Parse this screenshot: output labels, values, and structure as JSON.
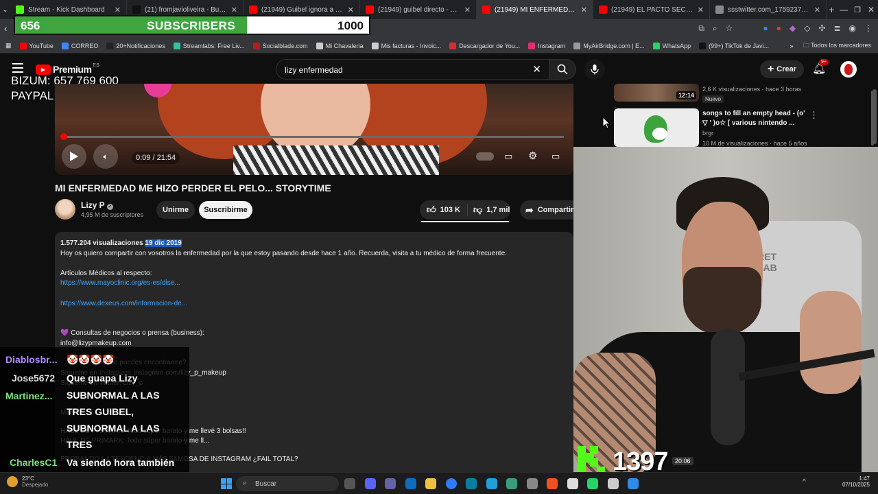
{
  "tabs": [
    {
      "title": "Stream - Kick Dashboard",
      "color": "#53fc18"
    },
    {
      "title": "(21) fromjavioliveira - Buscar /",
      "color": "#111111"
    },
    {
      "title": "(21949) Guibel ignora a JaviOli",
      "color": "#ff0000"
    },
    {
      "title": "(21949) guibel directo - YouTu",
      "color": "#ff0000"
    },
    {
      "title": "(21949) MI ENFERMEDAD ME I",
      "color": "#ff0000"
    },
    {
      "title": "(21949) EL PACTO SECRETO DE",
      "color": "#ff0000"
    },
    {
      "title": "ssstwitter.com_175923712069",
      "color": "#888888"
    }
  ],
  "bookmarks": [
    {
      "label": "YouTube",
      "color": "#ff0000"
    },
    {
      "label": "CORREO",
      "color": "#4285f4"
    },
    {
      "label": "20+Notificaciones",
      "color": "#222222"
    },
    {
      "label": "Streamlabs: Free Liv...",
      "color": "#31c3a2"
    },
    {
      "label": "Socialblade.com",
      "color": "#b71c1c"
    },
    {
      "label": "Mi Chavaleria",
      "color": "#cccccc"
    },
    {
      "label": "Mis facturas - Invoic...",
      "color": "#cccccc"
    },
    {
      "label": "Descargador de You...",
      "color": "#d32f2f"
    },
    {
      "label": "Instagram",
      "color": "#e1306c"
    },
    {
      "label": "MyAirBridge.com | E...",
      "color": "#999999"
    },
    {
      "label": "WhatsApp",
      "color": "#25d366"
    },
    {
      "label": "(99+) TikTok de Javi...",
      "color": "#111111"
    }
  ],
  "bookmarks_all": "Todos los marcadores",
  "sub_goal": {
    "current": "656",
    "label": "SUBSCRIBERS",
    "goal": "1000",
    "progress": 0.656
  },
  "yt": {
    "brand": "Premium",
    "region": "ES",
    "search_value": "lizy enfermedad",
    "create": "Crear",
    "notif_count": "9+"
  },
  "overlay": {
    "bizum": "BIZUM: 657 769 600",
    "paypal": "PAYPAL: javioliveira@live.com"
  },
  "video": {
    "time": "0:09 / 21:54",
    "progress": 0.007,
    "title": "MI ENFERMEDAD ME HIZO PERDER EL PELO... STORYTIME",
    "channel": "Lizy P",
    "subs": "4,95 M de suscriptores",
    "join": "Unirme",
    "subscribe": "Suscribirme",
    "likes": "103 K",
    "dislikes": "1,7 mil",
    "share": "Compartir"
  },
  "description": {
    "views": "1.577.204 visualizaciones",
    "date": "19 dic 2019",
    "line1": "Hoy os quiero compartir con vosotros la enfermedad por la que estoy pasando desde hace 1 año. Recuerda, visita a tu médico de forma frecuente.",
    "articles": "Artículos Médicos al respecto:",
    "link1": "https://www.mayoclinic.org/es-es/dise...",
    "link2": "https://www.dexeus.com/informacion-de...",
    "business": "💜 Consultas de negocios o prensa (business):",
    "email": "info@lizypmakeup.com",
    "where": "¿Dónde puedes encontrarme?",
    "instagram": "Sígueme en Instagram: instagram.com/lizy_p_makeup",
    "twitter": "Sígueme en Twitter: Lizy_p",
    "more": "Más...",
    "haul1": "HAUL DE PRIMARK: Todo súper barato y me llevé 3 bolsas!!",
    "haul2": "HAUL DE PRIMARK: Todo súper barato y me ll...",
    "trend": "PROBANDO LA TENDENCIA MÁS FAMOSA DE INSTAGRAM ¿FAIL TOTAL?"
  },
  "related": [
    {
      "duration": "12:14",
      "views": "2,6 K visualizaciones · hace 3 horas",
      "badge": "Nuevo"
    },
    {
      "title": "songs to fill an empty head - (o' ▽ ' )o☆ [ various nintendo ...",
      "channel": "brgr",
      "views": "10 M de visualizaciones · hace 5 años"
    }
  ],
  "chat": [
    {
      "user": "Diablosbr...",
      "color": "#b48cff",
      "msg": "🤡🤡🤡🤡"
    },
    {
      "user": "Jose5672",
      "color": "#dddddd",
      "msg": "Que guapa Lizy"
    },
    {
      "user": "Martinez...",
      "color": "#7fe07f",
      "msg": "SUBNORMAL A LAS TRES GUIBEL, SUBNORMAL A LAS TRES"
    },
    {
      "user": "CharlesC1",
      "color": "#7fe07f",
      "msg": "Va siendo hora también de que Dalas lo hunda"
    }
  ],
  "kick_count": "1397",
  "cam_time": "20:06",
  "taskbar": {
    "weather_temp": "23°C",
    "weather_desc": "Despejado",
    "search": "Buscar",
    "time": "1:47",
    "date": "07/10/2025"
  },
  "colors": {
    "yt_red": "#ff0000",
    "kick_green": "#53fc18",
    "link": "#3ea6ff"
  }
}
